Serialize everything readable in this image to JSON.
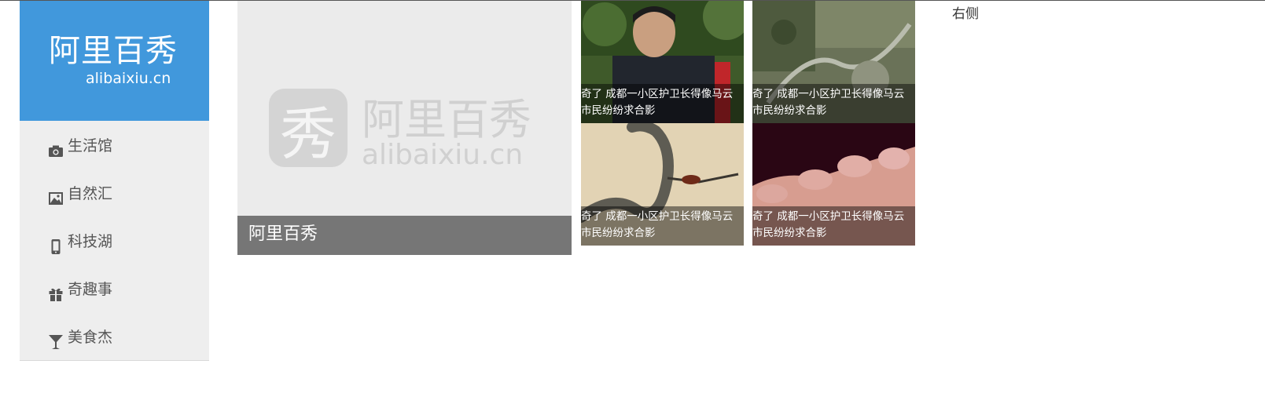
{
  "logo": {
    "cn": "阿里百秀",
    "en": "alibaixiu.cn"
  },
  "nav": [
    {
      "icon": "camera-icon",
      "label": "生活馆"
    },
    {
      "icon": "picture-icon",
      "label": "自然汇"
    },
    {
      "icon": "mobile-phone-icon",
      "label": "科技湖"
    },
    {
      "icon": "gift-icon",
      "label": "奇趣事"
    },
    {
      "icon": "cocktail-glass-icon",
      "label": "美食杰"
    }
  ],
  "feature": {
    "placeholder_logo_cn": "阿里百秀",
    "placeholder_logo_glyph": "秀",
    "placeholder_logo_en": "alibaixiu.cn",
    "caption": "阿里百秀"
  },
  "thumbs": [
    {
      "caption": "奇了 成都一小区护卫长得像马云 市民纷纷求合影"
    },
    {
      "caption": "奇了 成都一小区护卫长得像马云 市民纷纷求合影"
    },
    {
      "caption": "奇了 成都一小区护卫长得像马云 市民纷纷求合影"
    },
    {
      "caption": "奇了 成都一小区护卫长得像马云 市民纷纷求合影"
    }
  ],
  "right": {
    "label": "右侧"
  },
  "colors": {
    "brand": "#4198dc",
    "sidebar_bg": "#eeeeee",
    "caption_bg": "#767676"
  }
}
